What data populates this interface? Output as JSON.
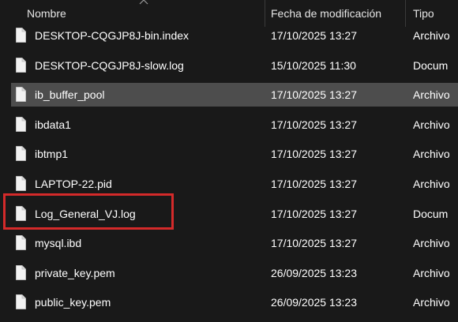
{
  "columns": {
    "name": "Nombre",
    "date": "Fecha de modificación",
    "type": "Tipo"
  },
  "sort_indicator": "chevron-up-icon",
  "files": [
    {
      "name": "DESKTOP-CQGJP8J-bin.index",
      "date": "17/10/2025 13:27",
      "type": "Archivo",
      "selected": false
    },
    {
      "name": "DESKTOP-CQGJP8J-slow.log",
      "date": "15/10/2025 11:30",
      "type": "Docum",
      "selected": false
    },
    {
      "name": "ib_buffer_pool",
      "date": "17/10/2025 13:27",
      "type": "Archivo",
      "selected": true
    },
    {
      "name": "ibdata1",
      "date": "17/10/2025 13:27",
      "type": "Archivo",
      "selected": false
    },
    {
      "name": "ibtmp1",
      "date": "17/10/2025 13:27",
      "type": "Archivo",
      "selected": false
    },
    {
      "name": "LAPTOP-22.pid",
      "date": "17/10/2025 13:27",
      "type": "Archivo",
      "selected": false
    },
    {
      "name": "Log_General_VJ.log",
      "date": "17/10/2025 13:27",
      "type": "Docum",
      "selected": false,
      "highlighted": true
    },
    {
      "name": "mysql.ibd",
      "date": "17/10/2025 13:27",
      "type": "Archivo",
      "selected": false
    },
    {
      "name": "private_key.pem",
      "date": "26/09/2025 13:23",
      "type": "Archivo",
      "selected": false
    },
    {
      "name": "public_key.pem",
      "date": "26/09/2025 13:23",
      "type": "Archivo",
      "selected": false
    }
  ],
  "colors": {
    "background": "#191919",
    "selected_row": "#4d4d4d",
    "highlight_border": "#d42a2a",
    "text": "#ffffff"
  },
  "icons": {
    "file": "file-icon"
  }
}
